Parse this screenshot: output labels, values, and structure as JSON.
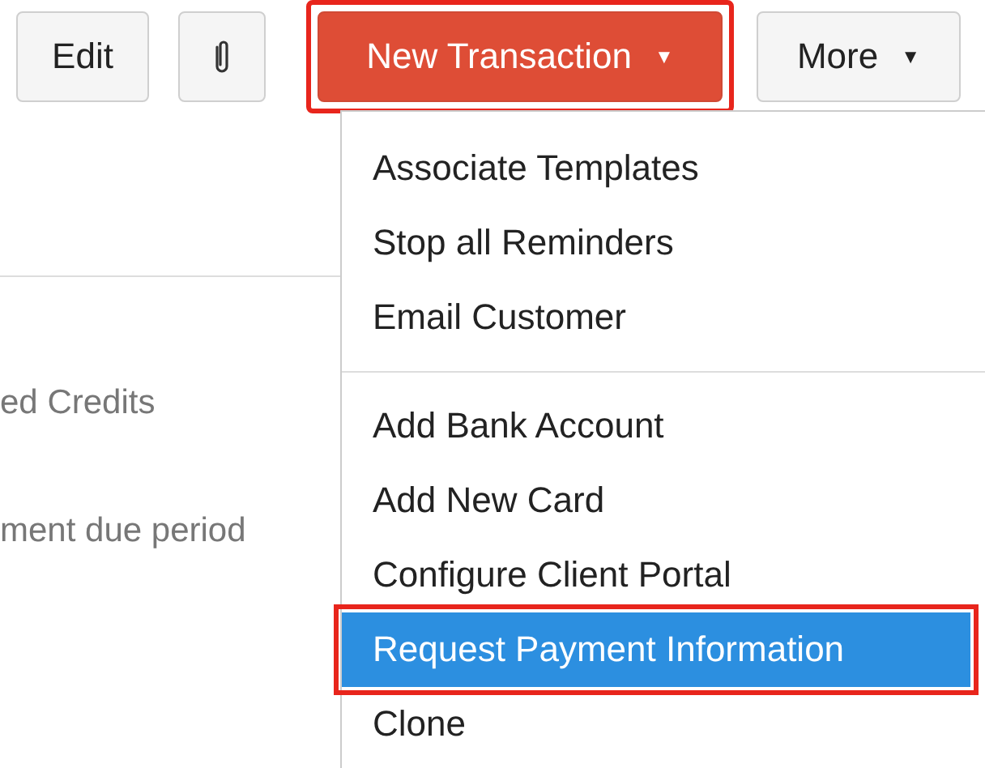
{
  "toolbar": {
    "buttons": [
      {
        "kind": "text",
        "label": "Edit",
        "highlighted": false
      },
      {
        "kind": "attach",
        "highlighted": false
      },
      {
        "kind": "primary",
        "label": "New Transaction",
        "caret": "▼",
        "highlighted": true
      },
      {
        "kind": "text",
        "label": "More",
        "caret": "▼",
        "highlighted": false
      }
    ]
  },
  "background_lines": [
    "ed Credits",
    "ment due period"
  ],
  "menu": {
    "groups": [
      [
        {
          "label": "Associate Templates",
          "selected": false,
          "highlighted": false
        },
        {
          "label": "Stop all Reminders",
          "selected": false,
          "highlighted": false
        },
        {
          "label": "Email Customer",
          "selected": false,
          "highlighted": false
        }
      ],
      [
        {
          "label": "Add Bank Account",
          "selected": false,
          "highlighted": false
        },
        {
          "label": "Add New Card",
          "selected": false,
          "highlighted": false
        },
        {
          "label": "Configure Client Portal",
          "selected": false,
          "highlighted": false
        },
        {
          "label": "Request Payment Information",
          "selected": true,
          "highlighted": true
        },
        {
          "label": "Clone",
          "selected": false,
          "highlighted": false
        }
      ]
    ]
  }
}
